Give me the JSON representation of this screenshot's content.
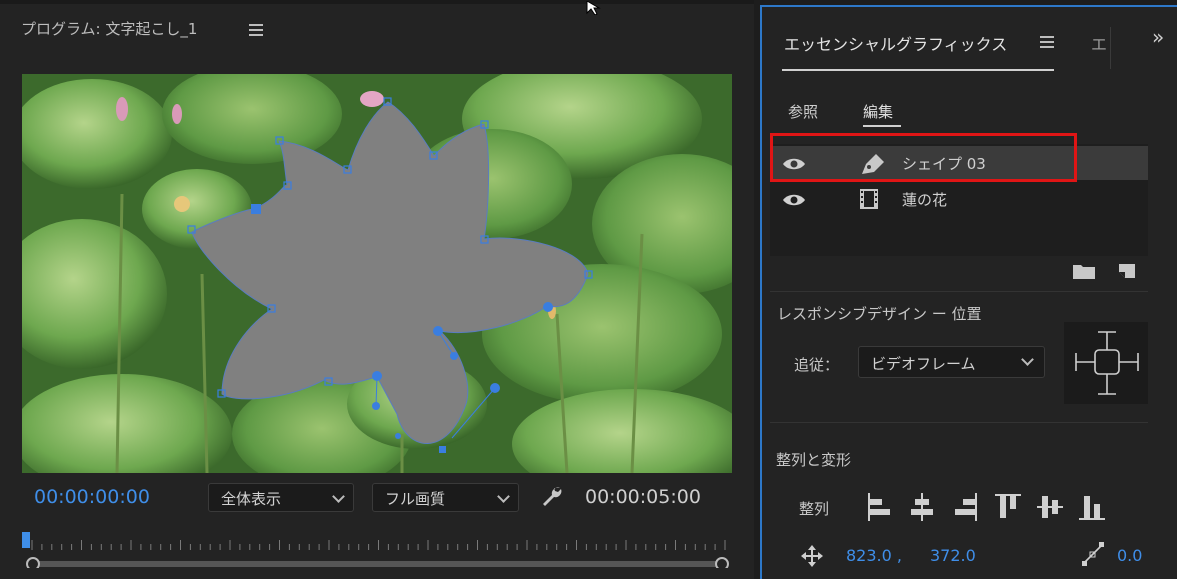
{
  "program_monitor": {
    "title": "プログラム: 文字起こし_1",
    "current_timecode": "00:00:00:00",
    "duration_timecode": "00:00:05:00",
    "zoom_select": "全体表示",
    "quality_select": "フル画質"
  },
  "essential_graphics": {
    "title": "エッセンシャルグラフィックス",
    "next_tab_label": "エ",
    "tabs": {
      "browse": "参照",
      "edit": "編集"
    },
    "layers": [
      {
        "name": "シェイプ 03",
        "type": "shape",
        "visible": true,
        "selected": true
      },
      {
        "name": "蓮の花",
        "type": "video",
        "visible": true,
        "selected": false
      }
    ],
    "responsive_label": "レスポンシブデザイン ー 位置",
    "follow_label": "追従：",
    "follow_value": "ビデオフレーム",
    "align_section_label": "整列と変形",
    "align_label": "整列",
    "position_x": "823.0 ,",
    "position_y": "372.0",
    "anchor_value": "0.0"
  },
  "colors": {
    "accent_blue": "#3f8ee8",
    "highlight_red": "#e01515",
    "panel_bg": "#232323",
    "shape_fill": "#808080"
  },
  "icons": [
    "hamburger-menu-icon",
    "wrench-icon",
    "eye-icon",
    "pen-icon",
    "film-icon",
    "new-folder-icon",
    "new-layer-icon",
    "align-left-icon",
    "align-center-h-icon",
    "align-right-icon",
    "align-top-icon",
    "align-center-v-icon",
    "align-bottom-icon",
    "position-move-icon",
    "anchor-point-icon",
    "overflow-chevron-icon"
  ]
}
